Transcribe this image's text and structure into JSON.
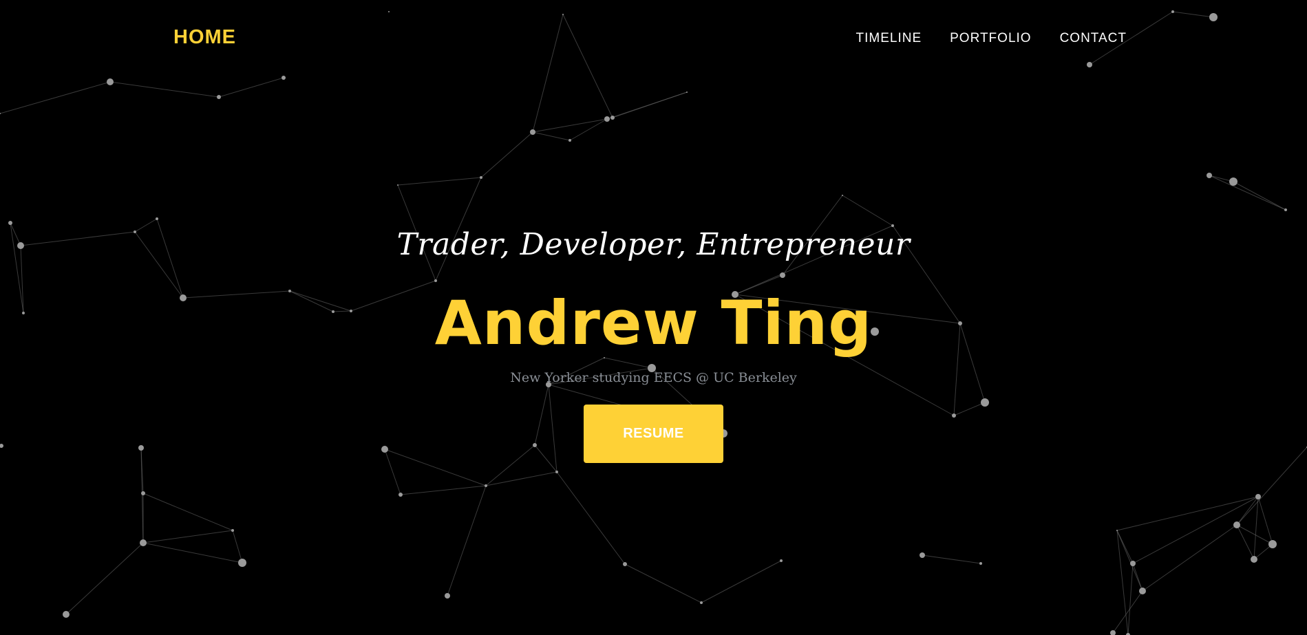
{
  "nav": {
    "brand": "HOME",
    "links": [
      {
        "label": "TIMELINE"
      },
      {
        "label": "PORTFOLIO"
      },
      {
        "label": "CONTACT"
      }
    ]
  },
  "hero": {
    "subheading": "Trader, Developer, Entrepreneur",
    "heading": "Andrew Ting",
    "tagline": "New Yorker studying EECS @ UC Berkeley",
    "cta_label": "RESUME"
  },
  "colors": {
    "background": "#000000",
    "accent": "#fed136",
    "nav_text": "#ffffff",
    "tagline_text": "#8a8f96"
  }
}
